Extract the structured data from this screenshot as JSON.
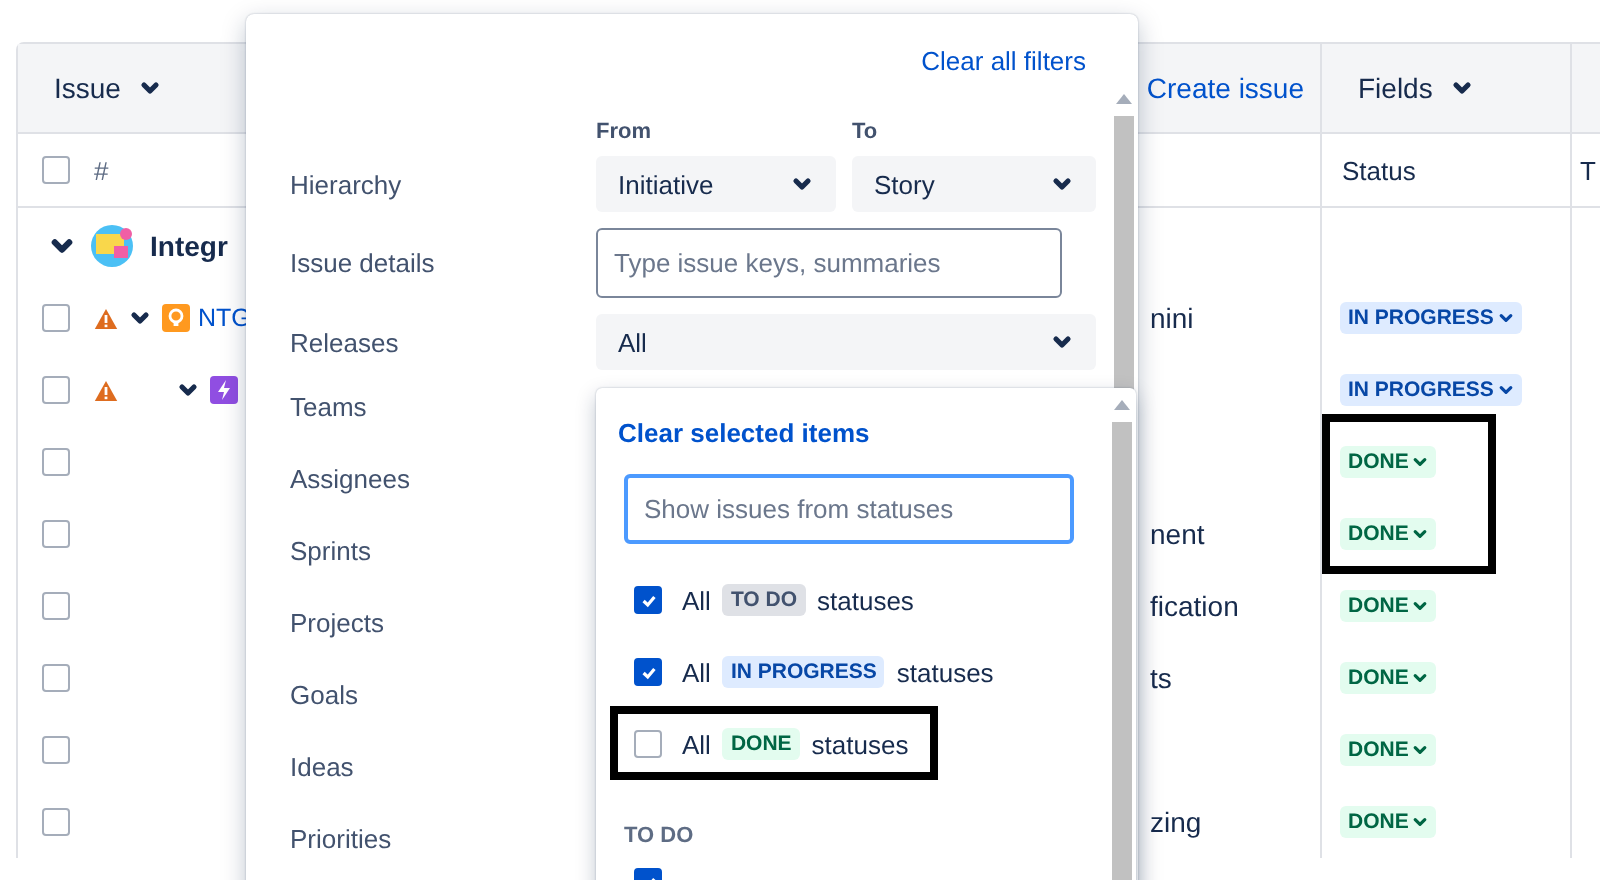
{
  "table": {
    "header": {
      "issue_menu": "Issue",
      "create_link": "Create issue",
      "fields_menu": "Fields"
    },
    "select_all": {
      "checked": false
    },
    "columns": [
      "#",
      "Status",
      "T"
    ],
    "group": {
      "title": "Integr",
      "expanded": true
    },
    "rows": [
      {
        "kind": "idea",
        "checked": false,
        "key": "NTG",
        "summary": "nini",
        "status": {
          "label": "IN PROGRESS",
          "kind": "inprogress"
        }
      },
      {
        "kind": "epic",
        "checked": false,
        "status": {
          "label": "IN PROGRESS",
          "kind": "inprogress"
        }
      },
      {
        "kind": "plain",
        "checked": false,
        "status": {
          "label": "DONE",
          "kind": "done"
        }
      },
      {
        "kind": "plain",
        "checked": false,
        "summary": "nent",
        "status": {
          "label": "DONE",
          "kind": "done"
        }
      },
      {
        "kind": "plain",
        "checked": false,
        "summary": "fication",
        "status": {
          "label": "DONE",
          "kind": "done"
        }
      },
      {
        "kind": "plain",
        "checked": false,
        "summary": "ts",
        "status": {
          "label": "DONE",
          "kind": "done"
        }
      },
      {
        "kind": "plain",
        "checked": false,
        "status": {
          "label": "DONE",
          "kind": "done"
        }
      },
      {
        "kind": "plain",
        "checked": false,
        "summary": "zing",
        "status": {
          "label": "DONE",
          "kind": "done"
        }
      }
    ]
  },
  "filter_panel": {
    "clear_all": "Clear all filters",
    "hierarchy": {
      "label": "Hierarchy",
      "from_label": "From",
      "from_value": "Initiative",
      "to_label": "To",
      "to_value": "Story"
    },
    "issue_details": {
      "label": "Issue details",
      "placeholder": "Type issue keys, summaries"
    },
    "releases": {
      "label": "Releases",
      "value": "All"
    },
    "other_filters": [
      "Teams",
      "Assignees",
      "Sprints",
      "Projects",
      "Goals",
      "Ideas",
      "Priorities"
    ],
    "status_menu": {
      "clear": "Clear selected items",
      "placeholder": "Show issues from statuses",
      "options": [
        {
          "prefix": "All",
          "lozenge": "TO DO",
          "kind": "todo",
          "suffix": "statuses",
          "checked": true,
          "highlighted": false
        },
        {
          "prefix": "All",
          "lozenge": "IN PROGRESS",
          "kind": "inprogress",
          "suffix": "statuses",
          "checked": true,
          "highlighted": false
        },
        {
          "prefix": "All",
          "lozenge": "DONE",
          "kind": "done",
          "suffix": "statuses",
          "checked": false,
          "highlighted": true
        }
      ],
      "group_heading": "TO DO",
      "group_options": [
        {
          "checked": true
        }
      ]
    }
  }
}
